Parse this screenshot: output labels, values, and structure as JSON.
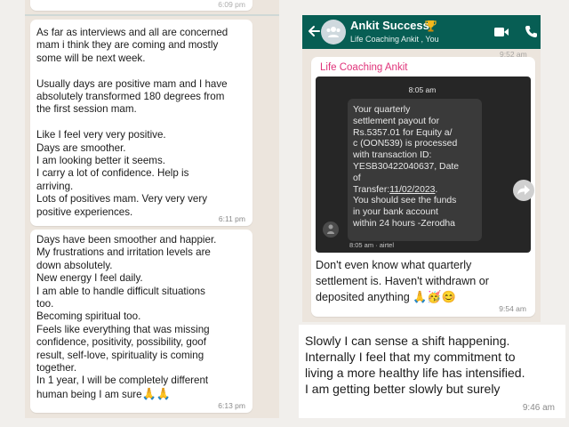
{
  "left_chat": {
    "top_cut_time": "6:09 pm",
    "message_1": {
      "text": "As far as interviews and all are concerned\nmam i think they are coming and mostly\nsome will be next week.\n\nUsually days are positive mam and I have\nabsolutely transformed 180 degrees from\nthe first session mam.\n\nLike I feel very very positive.\nDays are smoother.\nI am looking better it seems.\nI carry a lot of confidence. Help is\narriving.\nLots of positives mam. Very very very\npositive experiences.",
      "time": "6:11 pm"
    },
    "message_2": {
      "text": "Days have been smoother and happier.\nMy frustrations and irritation levels are\ndown absolutely.\nNew energy I feel daily.\nI am able to handle difficult situations\ntoo.\nBecoming spiritual too.\nFeels like everything that was missing\nconfidence, positivity, possibility, goof\nresult, self-love, spirituality is coming\ntogether.\nIn 1 year, I will be completely different\nhuman being I am sure",
      "emoji": "🙏🙏",
      "time": "6:13 pm"
    }
  },
  "right_chat": {
    "header": {
      "title": "Ankit Success",
      "subtitle": "Life Coaching Ankit , You",
      "header_color": "#075e54"
    },
    "peek_time": "9:52 am",
    "message": {
      "sender": "Life Coaching Ankit",
      "image": {
        "time_chip": "8:05 am",
        "sms_text_part1": "Your quarterly\nsettlement payout for\nRs.5357.01 for Equity a/\nc (OON539) is processed\nwith transaction ID:\nYESB30422040637, Date\nof\n      Transfer:",
        "sms_date": "11/02/2023",
        "sms_text_part2": ".\nYou should see the funds\nin your bank account\nwithin 24 hours -Zerodha",
        "sms_meta": "8:05 am · airtel"
      },
      "text": "Don't even know what quarterly\nsettlement is. Haven't withdrawn or\ndeposited anything",
      "emoji": "🙏🥳😊",
      "time": "9:54 am"
    }
  },
  "text_card": {
    "text": "Slowly I can sense a shift happening.\nInternally I feel that my commitment to\nliving a more healthy life has intensified.\nI am getting better slowly but surely",
    "time": "9:46 am"
  },
  "colors": {
    "chat_background": "#ece5dd",
    "sender_name": "#e0337a"
  },
  "icons": [
    "back-arrow-icon",
    "group-avatar-icon",
    "trophy-icon",
    "video-call-icon",
    "phone-call-icon",
    "forward-icon",
    "person-icon"
  ]
}
